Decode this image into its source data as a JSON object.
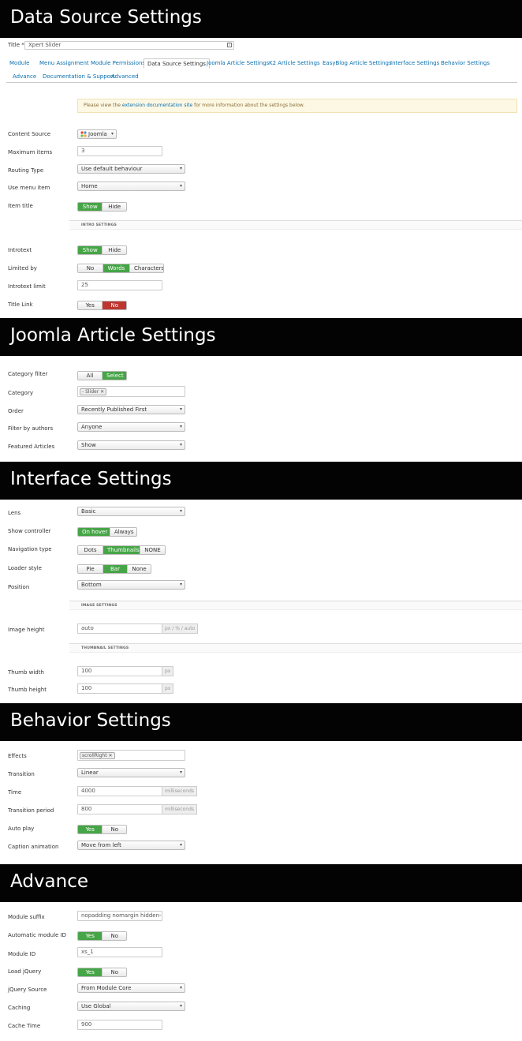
{
  "sections": {
    "data_source": "Data Source Settings",
    "joomla_article": "Joomla Article Settings",
    "interface": "Interface Settings",
    "behavior": "Behavior Settings",
    "advance": "Advance"
  },
  "title_field": {
    "label": "Title *",
    "value": "Xpert Slider"
  },
  "tabs": [
    "Module",
    "Menu Assignment",
    "Module Permissions",
    "Data Source Settings",
    "Joomla Article Settings",
    "K2 Article Settings",
    "EasyBlog Article Settings",
    "Interface Settings",
    "Behavior Settings",
    "Advance",
    "Documentation & Support",
    "Advanced"
  ],
  "alert": {
    "before": "Please view the ",
    "link": "extension documentation site",
    "after": " for more information about the settings below."
  },
  "data_source": {
    "content_source": {
      "label": "Content Source",
      "value": "Joomla"
    },
    "max_items": {
      "label": "Maximum items",
      "value": "3"
    },
    "routing_type": {
      "label": "Routing Type",
      "value": "Use default behaviour"
    },
    "use_menu_item": {
      "label": "Use menu item",
      "value": "Home"
    },
    "item_title": {
      "label": "Item title",
      "options": [
        "Show",
        "Hide"
      ],
      "selected": "Show"
    },
    "intro_heading": "INTRO SETTINGS",
    "introtext": {
      "label": "Introtext",
      "options": [
        "Show",
        "Hide"
      ],
      "selected": "Show"
    },
    "limited_by": {
      "label": "Limited by",
      "options": [
        "No",
        "Words",
        "Characters"
      ],
      "selected": "Words"
    },
    "introtext_limit": {
      "label": "Introtext limit",
      "value": "25"
    },
    "title_link": {
      "label": "Title Link",
      "options": [
        "Yes",
        "No"
      ],
      "selected": "No"
    }
  },
  "joomla_article": {
    "category_filter": {
      "label": "Category filter",
      "options": [
        "All",
        "Select"
      ],
      "selected": "Select"
    },
    "category": {
      "label": "Category",
      "tag": "- Slider"
    },
    "order": {
      "label": "Order",
      "value": "Recently Published First"
    },
    "filter_by_authors": {
      "label": "Filter by authors",
      "value": "Anyone"
    },
    "featured_articles": {
      "label": "Featured Articles",
      "value": "Show"
    }
  },
  "interface": {
    "lens": {
      "label": "Lens",
      "value": "Basic"
    },
    "show_controller": {
      "label": "Show controller",
      "options": [
        "On hover",
        "Always"
      ],
      "selected": "On hover"
    },
    "navigation_type": {
      "label": "Navigation type",
      "options": [
        "Dots",
        "Thumbnails",
        "NONE"
      ],
      "selected": "Thumbnails"
    },
    "loader_style": {
      "label": "Loader style",
      "options": [
        "Pie",
        "Bar",
        "None"
      ],
      "selected": "Bar"
    },
    "position": {
      "label": "Position",
      "value": "Bottom"
    },
    "image_heading": "IMAGE SETTINGS",
    "image_height": {
      "label": "Image height",
      "value": "auto",
      "unit": "px / % / auto"
    },
    "thumbnail_heading": "THUMBNAIL SETTINGS",
    "thumb_width": {
      "label": "Thumb width",
      "value": "100",
      "unit": "px"
    },
    "thumb_height": {
      "label": "Thumb height",
      "value": "100",
      "unit": "px"
    }
  },
  "behavior": {
    "effects": {
      "label": "Effects",
      "tag": "scrollRight"
    },
    "transition": {
      "label": "Transition",
      "value": "Linear"
    },
    "time": {
      "label": "Time",
      "value": "4000",
      "unit": "milliseconds"
    },
    "transition_period": {
      "label": "Transition period",
      "value": "800",
      "unit": "milliseconds"
    },
    "auto_play": {
      "label": "Auto play",
      "options": [
        "Yes",
        "No"
      ],
      "selected": "Yes"
    },
    "caption_animation": {
      "label": "Caption animation",
      "value": "Move from left"
    }
  },
  "advance": {
    "module_suffix": {
      "label": "Module suffix",
      "value": "nopadding nomargin hidden-phone"
    },
    "automatic_module_id": {
      "label": "Automatic module ID",
      "options": [
        "Yes",
        "No"
      ],
      "selected": "Yes"
    },
    "module_id": {
      "label": "Module ID",
      "value": "xs_1"
    },
    "load_jquery": {
      "label": "Load jQuery",
      "options": [
        "Yes",
        "No"
      ],
      "selected": "Yes"
    },
    "jquery_source": {
      "label": "jQuery Source",
      "value": "From Module Core"
    },
    "caching": {
      "label": "Caching",
      "value": "Use Global"
    },
    "cache_time": {
      "label": "Cache Time",
      "value": "900"
    }
  }
}
